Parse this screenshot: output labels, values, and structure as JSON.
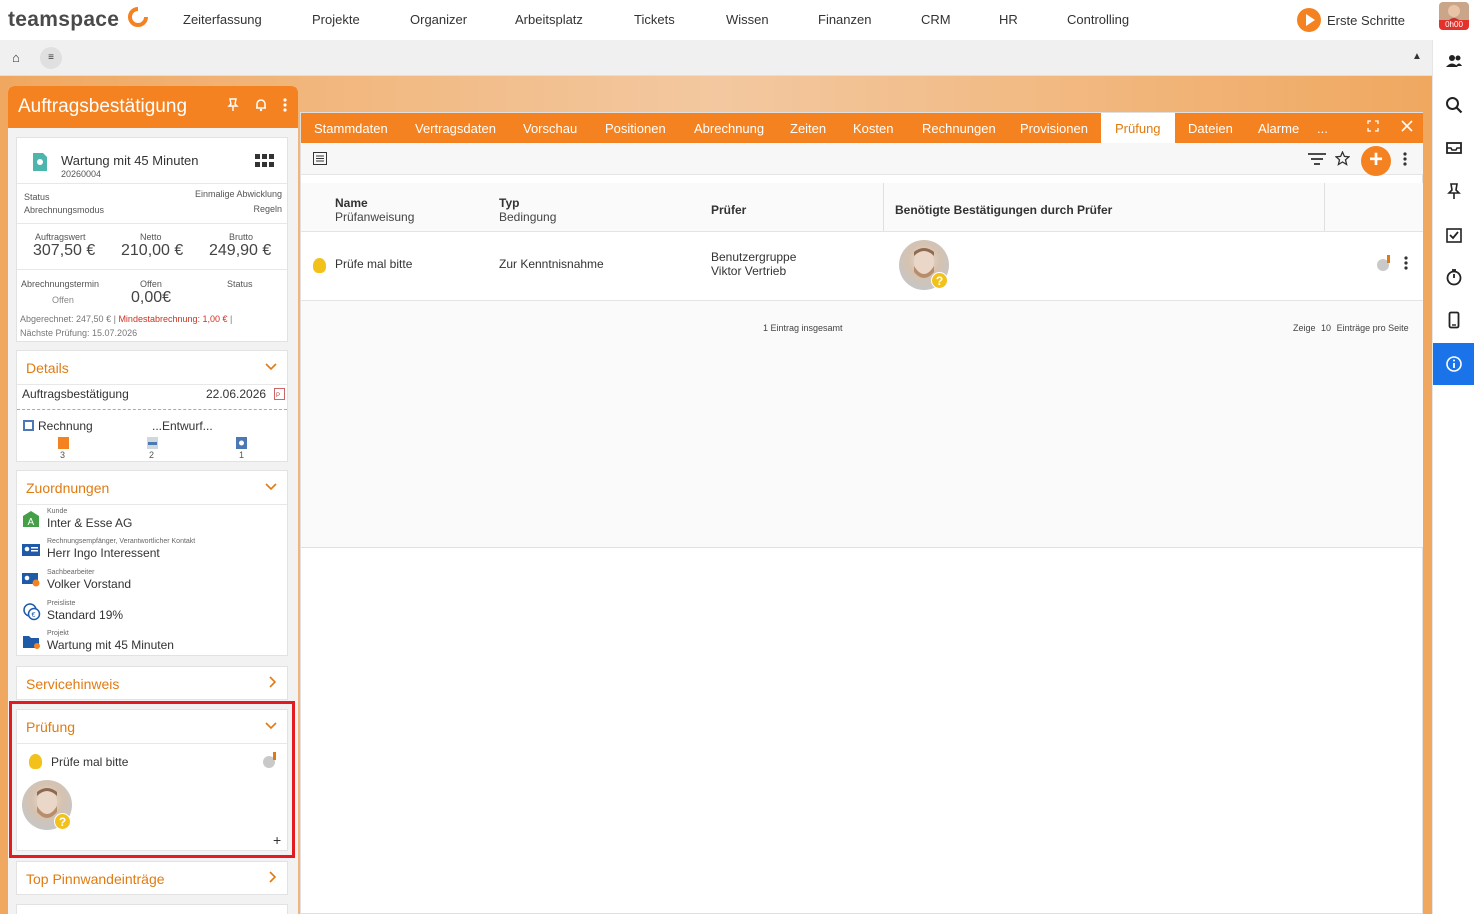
{
  "brand": {
    "name": "teamspace",
    "accent": "#f58220"
  },
  "topnav": {
    "items": [
      "Zeiterfassung",
      "Projekte",
      "Organizer",
      "Arbeitsplatz",
      "Tickets",
      "Wissen",
      "Finanzen",
      "CRM",
      "HR",
      "Controlling"
    ],
    "erste_schritte": "Erste Schritte",
    "timer": "0h00"
  },
  "subbar": {
    "home_icon": "⌂",
    "menu_icon": "≡",
    "up_icon": "▲"
  },
  "rightbar": {
    "icons": [
      "users-icon",
      "search-icon",
      "inbox-icon",
      "pin-icon",
      "checklist-icon",
      "stopwatch-icon",
      "mobile-icon",
      "info-icon"
    ]
  },
  "left": {
    "title": "Auftragsbestätigung",
    "summary": {
      "name": "Wartung mit 45 Minuten",
      "number": "20260004",
      "status_label": "Status",
      "status_value": "Einmalige Abwicklung",
      "mode_label": "Abrechnungsmodus",
      "mode_value": "Regeln",
      "auftragswert_label": "Auftragswert",
      "auftragswert": "307,50 €",
      "netto_label": "Netto",
      "netto": "210,00 €",
      "brutto_label": "Brutto",
      "brutto": "249,90 €",
      "termin_label": "Abrechnungstermin",
      "termin_value": "Offen",
      "offen_label": "Offen",
      "offen_value": "0,00€",
      "status2_label": "Status",
      "abgerechnet": "Abgerechnet: 247,50 € |",
      "mindest": "Mindestabrechnung: 1,00 €",
      "sep": "|",
      "naechste": "Nächste Prüfung: 15.07.2026"
    },
    "details": {
      "title": "Details",
      "doc_label": "Auftragsbestätigung",
      "doc_date": "22.06.2026",
      "rechnung": "Rechnung",
      "entwurf": "...Entwurf...",
      "counts": [
        "3",
        "2",
        "1"
      ]
    },
    "zuordnungen": {
      "title": "Zuordnungen",
      "items": [
        {
          "small": "Kunde",
          "value": "Inter & Esse AG"
        },
        {
          "small": "Rechnungsempfänger, Verantwortlicher Kontakt",
          "value": "Herr Ingo Interessent"
        },
        {
          "small": "Sachbearbeiter",
          "value": "Volker Vorstand"
        },
        {
          "small": "Preisliste",
          "value": "Standard 19%"
        },
        {
          "small": "Projekt",
          "value": "Wartung mit 45 Minuten"
        }
      ]
    },
    "servicehinweis": {
      "title": "Servicehinweis"
    },
    "pruefung": {
      "title": "Prüfung",
      "item": "Prüfe mal bitte",
      "plus": "+"
    },
    "pinnwand": {
      "title": "Top Pinnwandeinträge"
    }
  },
  "main": {
    "tabs": [
      "Stammdaten",
      "Vertragsdaten",
      "Vorschau",
      "Positionen",
      "Abrechnung",
      "Zeiten",
      "Kosten",
      "Rechnungen",
      "Provisionen",
      "Prüfung",
      "Dateien",
      "Alarme",
      "..."
    ],
    "active_tab": "Prüfung",
    "columns": {
      "name": "Name",
      "name_sub": "Prüfanweisung",
      "typ": "Typ",
      "typ_sub": "Bedingung",
      "pruefer": "Prüfer",
      "bestaetigungen": "Benötigte Bestätigungen durch Prüfer"
    },
    "row": {
      "name": "Prüfe mal bitte",
      "typ": "Zur Kenntnisnahme",
      "pruefer1": "Benutzergruppe",
      "pruefer2": "Viktor Vertrieb"
    },
    "footer": {
      "total": "1 Eintrag insgesamt",
      "zeige": "Zeige",
      "count": "10",
      "pro_seite": "Einträge pro Seite"
    }
  }
}
